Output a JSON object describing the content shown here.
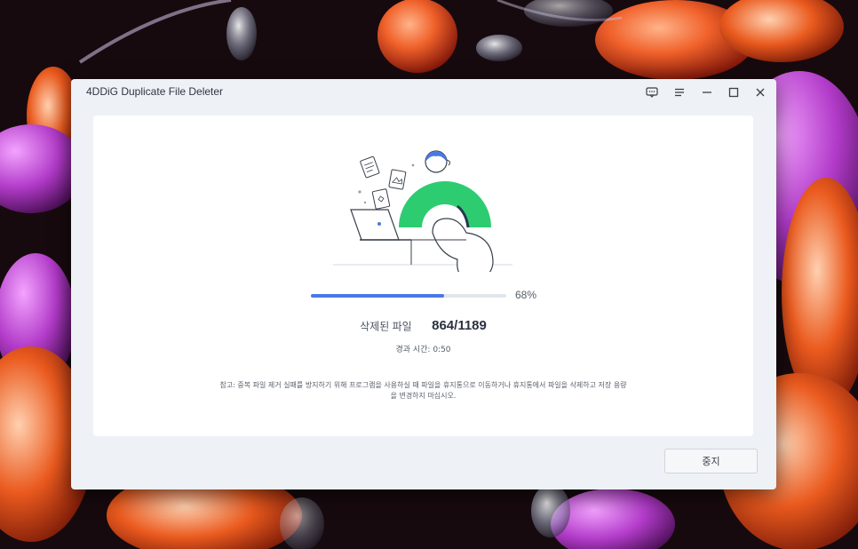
{
  "window": {
    "title": "4DDiG Duplicate File Deleter"
  },
  "title_controls": [
    {
      "name": "feedback-icon"
    },
    {
      "name": "menu-icon"
    },
    {
      "name": "minimize-icon"
    },
    {
      "name": "maximize-icon"
    },
    {
      "name": "close-icon"
    }
  ],
  "progress": {
    "value": 0.68,
    "percent_label": "68%"
  },
  "deleted": {
    "label": "삭제된 파일",
    "count": "864/1189"
  },
  "elapsed": "경과 시간: 0:50",
  "note": "참고: 중복 파일 제거 실패를 방지하기 위해 프로그램을 사용하실 때 파일을 휴지통으로 이동하거나 휴지통에서 파일을 삭제하고 저장 용량을 변경하지 마십시오.",
  "stop_button": "중지",
  "colors": {
    "accent": "#4a78e6",
    "illustration_green": "#2ecc71"
  }
}
